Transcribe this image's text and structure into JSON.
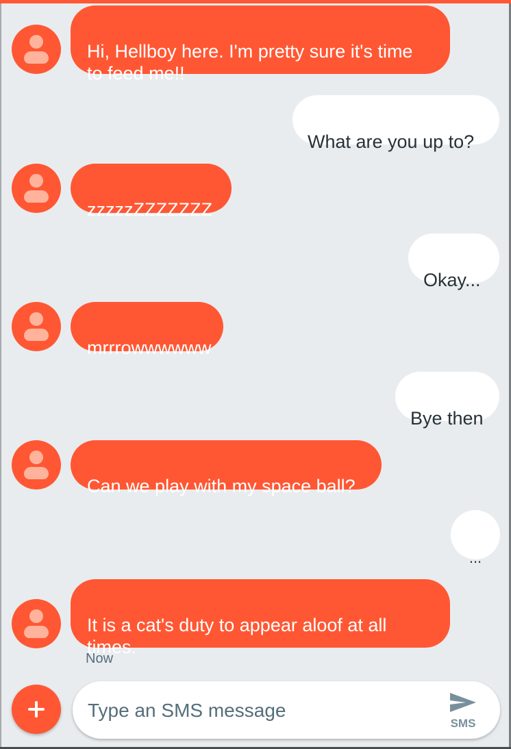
{
  "messages": [
    {
      "direction": "incoming",
      "text": "Hi, Hellboy here. I'm pretty sure it's time\nto feed me!!"
    },
    {
      "direction": "outgoing",
      "text": "What are you up to?"
    },
    {
      "direction": "incoming",
      "text": "zzzzzZZZZZZZ"
    },
    {
      "direction": "outgoing",
      "text": "Okay..."
    },
    {
      "direction": "incoming",
      "text": "mrrrowwwwww"
    },
    {
      "direction": "outgoing",
      "text": "Bye then"
    },
    {
      "direction": "incoming",
      "text": "Can we play with my space ball?"
    },
    {
      "direction": "outgoing",
      "text": "..."
    },
    {
      "direction": "incoming",
      "text": "It is a cat's duty to appear aloof at all\ntimes."
    }
  ],
  "last_message_time": "Now",
  "compose": {
    "placeholder": "Type an SMS message",
    "value": "",
    "send_label": "SMS"
  },
  "icons": {
    "avatar": "person-avatar-icon",
    "add": "plus-icon",
    "send": "send-icon"
  },
  "colors": {
    "accent": "#ff5733",
    "background": "#e9ecef",
    "outgoing_bubble": "#ffffff",
    "incoming_text": "#ffffff",
    "outgoing_text": "#263238",
    "muted_text": "#546e7a",
    "send_icon": "#78909c"
  }
}
